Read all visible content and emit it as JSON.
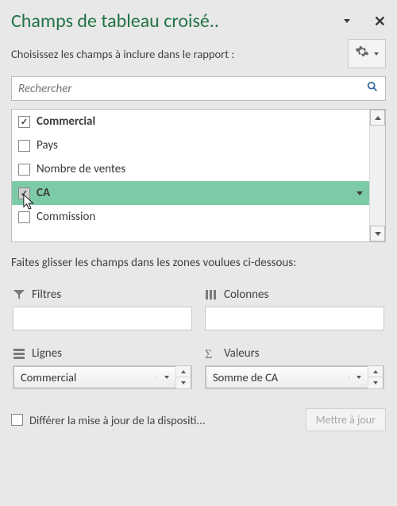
{
  "header": {
    "title": "Champs de tableau croisé..",
    "close_glyph": "✕"
  },
  "instructions": {
    "choose_fields": "Choisissez les champs à inclure dans le rapport :",
    "drag_zones": "Faites glisser les champs dans les zones voulues ci-dessous:"
  },
  "search": {
    "placeholder": "Rechercher"
  },
  "fields": [
    {
      "label": "Commercial",
      "checked": true,
      "bold": true,
      "selected": false
    },
    {
      "label": "Pays",
      "checked": false,
      "bold": false,
      "selected": false
    },
    {
      "label": "Nombre de ventes",
      "checked": false,
      "bold": false,
      "selected": false
    },
    {
      "label": "CA",
      "checked": true,
      "bold": true,
      "selected": true
    },
    {
      "label": "Commission",
      "checked": false,
      "bold": false,
      "selected": false
    }
  ],
  "zones": {
    "filters": {
      "title": "Filtres"
    },
    "columns": {
      "title": "Colonnes"
    },
    "rows": {
      "title": "Lignes",
      "item": "Commercial"
    },
    "values": {
      "title": "Valeurs",
      "item": "Somme de CA"
    }
  },
  "footer": {
    "defer_label": "Différer la mise à jour de la dispositi...",
    "update_button": "Mettre à jour"
  }
}
